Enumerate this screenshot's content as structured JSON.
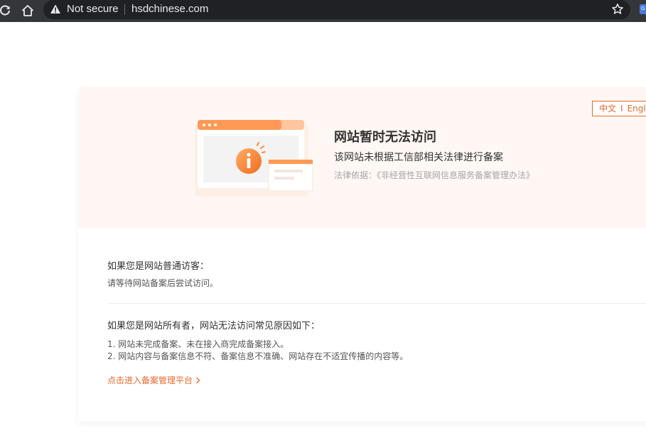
{
  "browser": {
    "security_label": "Not secure",
    "url": "hsdchinese.com"
  },
  "language_switch": {
    "chinese": "中文",
    "separator": "I",
    "english": "English"
  },
  "banner": {
    "title": "网站暂时无法访问",
    "subtitle": "该网站未根据工信部相关法律进行备案",
    "law_basis": "法律依据：《非经营性互联网信息服务备案管理办法》"
  },
  "visitor_section": {
    "heading": "如果您是网站普通访客：",
    "text": "请等待网站备案后尝试访问。"
  },
  "owner_section": {
    "heading": "如果您是网站所有者，网站无法访问常见原因如下：",
    "reasons": [
      "1. 网站未完成备案、未在接入商完成备案接入。",
      "2. 网站内容与备案信息不符、备案信息不准确、网站存在不适宜传播的内容等。"
    ]
  },
  "portal_link": {
    "label": "点击进入备案管理平台"
  },
  "colors": {
    "accent": "#e66a2c",
    "banner_bg": "#fff7f3",
    "chrome_bg": "#35363a",
    "omnibox_bg": "#202124"
  }
}
